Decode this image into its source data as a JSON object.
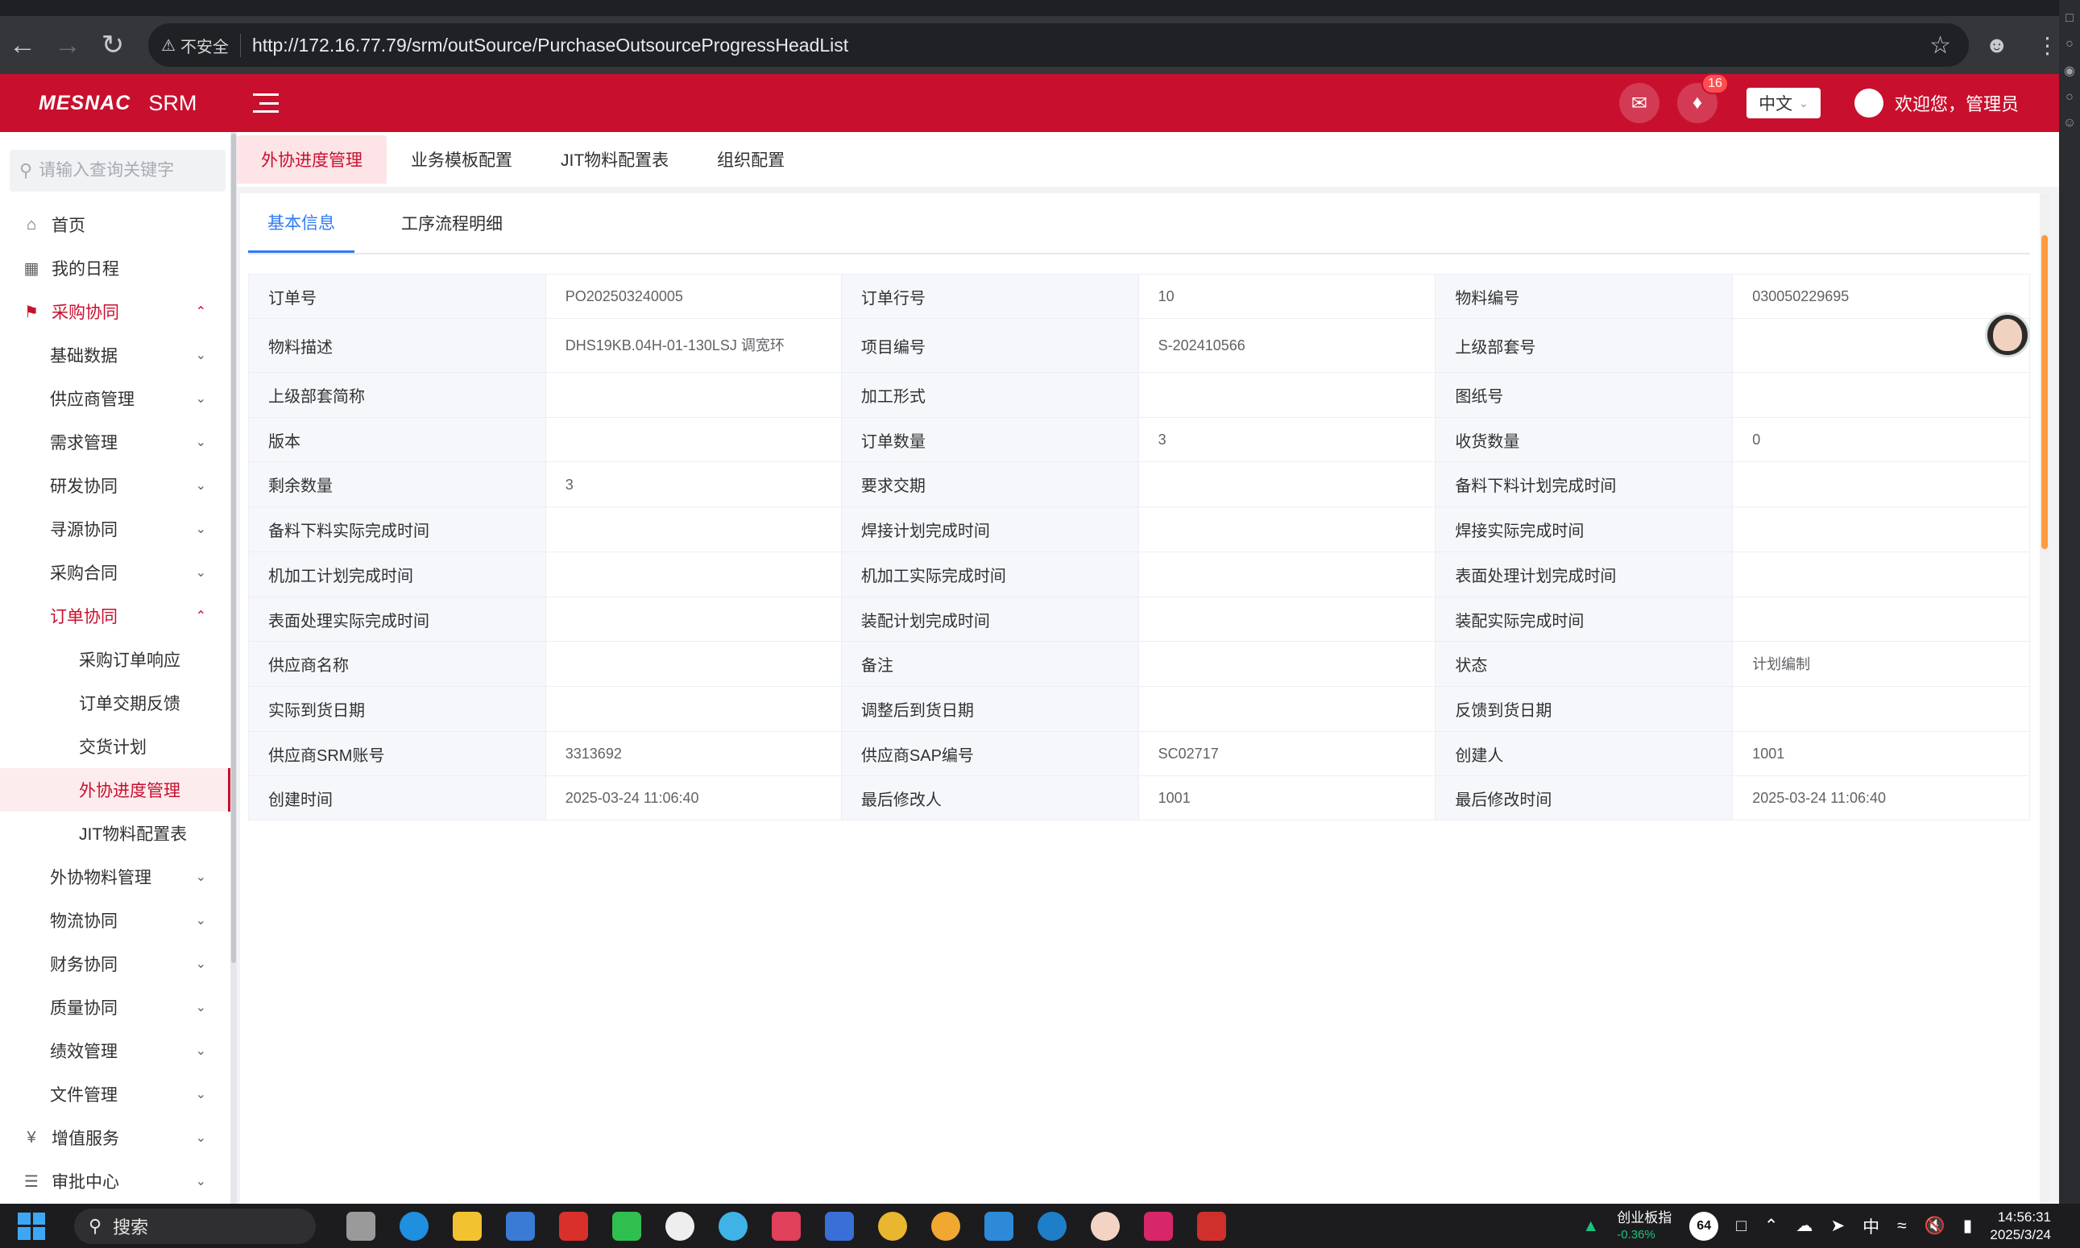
{
  "browser": {
    "insecure_label": "不安全",
    "url": "http://172.16.77.79/srm/outSource/PurchaseOutsourceProgressHeadList"
  },
  "header": {
    "logo": "MESNAC",
    "app_name": "SRM",
    "notification_count": "16",
    "language": "中文",
    "welcome": "欢迎您，管理员"
  },
  "sidebar": {
    "search_placeholder": "请输入查询关键字",
    "items": [
      {
        "label": "首页",
        "icon": "home-icon",
        "level": 1
      },
      {
        "label": "我的日程",
        "icon": "calendar-icon",
        "level": 1
      },
      {
        "label": "采购协同",
        "icon": "flag-icon",
        "level": 1,
        "state": "open"
      },
      {
        "label": "基础数据",
        "level": 2
      },
      {
        "label": "供应商管理",
        "level": 2
      },
      {
        "label": "需求管理",
        "level": 2
      },
      {
        "label": "研发协同",
        "level": 2
      },
      {
        "label": "寻源协同",
        "level": 2
      },
      {
        "label": "采购合同",
        "level": 2
      },
      {
        "label": "订单协同",
        "level": 2,
        "state": "open"
      },
      {
        "label": "采购订单响应",
        "level": 3
      },
      {
        "label": "订单交期反馈",
        "level": 3
      },
      {
        "label": "交货计划",
        "level": 3
      },
      {
        "label": "外协进度管理",
        "level": 3,
        "state": "active"
      },
      {
        "label": "JIT物料配置表",
        "level": 3
      },
      {
        "label": "外协物料管理",
        "level": 2
      },
      {
        "label": "物流协同",
        "level": 2
      },
      {
        "label": "财务协同",
        "level": 2
      },
      {
        "label": "质量协同",
        "level": 2
      },
      {
        "label": "绩效管理",
        "level": 2
      },
      {
        "label": "文件管理",
        "level": 2
      },
      {
        "label": "增值服务",
        "icon": "yen-icon",
        "level": 1
      },
      {
        "label": "审批中心",
        "icon": "doc-icon",
        "level": 1
      }
    ]
  },
  "page_tabs": [
    "外协进度管理",
    "业务模板配置",
    "JIT物料配置表",
    "组织配置"
  ],
  "inner_tabs": [
    "基本信息",
    "工序流程明细"
  ],
  "detail_rows": [
    [
      [
        "订单号",
        "PO202503240005"
      ],
      [
        "订单行号",
        "10"
      ],
      [
        "物料编号",
        "030050229695"
      ]
    ],
    [
      [
        "物料描述",
        "DHS19KB.04H-01-130LSJ 调宽环"
      ],
      [
        "项目编号",
        "S-202410566"
      ],
      [
        "上级部套号",
        ""
      ]
    ],
    [
      [
        "上级部套简称",
        ""
      ],
      [
        "加工形式",
        ""
      ],
      [
        "图纸号",
        ""
      ]
    ],
    [
      [
        "版本",
        ""
      ],
      [
        "订单数量",
        "3"
      ],
      [
        "收货数量",
        "0"
      ]
    ],
    [
      [
        "剩余数量",
        "3"
      ],
      [
        "要求交期",
        ""
      ],
      [
        "备料下料计划完成时间",
        ""
      ]
    ],
    [
      [
        "备料下料实际完成时间",
        ""
      ],
      [
        "焊接计划完成时间",
        ""
      ],
      [
        "焊接实际完成时间",
        ""
      ]
    ],
    [
      [
        "机加工计划完成时间",
        ""
      ],
      [
        "机加工实际完成时间",
        ""
      ],
      [
        "表面处理计划完成时间",
        ""
      ]
    ],
    [
      [
        "表面处理实际完成时间",
        ""
      ],
      [
        "装配计划完成时间",
        ""
      ],
      [
        "装配实际完成时间",
        ""
      ]
    ],
    [
      [
        "供应商名称",
        ""
      ],
      [
        "备注",
        ""
      ],
      [
        "状态",
        "计划编制"
      ]
    ],
    [
      [
        "实际到货日期",
        ""
      ],
      [
        "调整后到货日期",
        ""
      ],
      [
        "反馈到货日期",
        ""
      ]
    ],
    [
      [
        "供应商SRM账号",
        "3313692"
      ],
      [
        "供应商SAP编号",
        "SC02717"
      ],
      [
        "创建人",
        "1001"
      ]
    ],
    [
      [
        "创建时间",
        "2025-03-24 11:06:40"
      ],
      [
        "最后修改人",
        "1001"
      ],
      [
        "最后修改时间",
        "2025-03-24 11:06:40"
      ]
    ]
  ],
  "taskbar": {
    "search_label": "搜索",
    "stock_name": "创业板指",
    "stock_change": "-0.36%",
    "temp": "64",
    "ime": "中",
    "time": "14:56:31",
    "date": "2025/3/24"
  },
  "colors": {
    "brand": "#c8102e",
    "active_blue": "#2f7bf6",
    "label_bg": "#f5f7fa"
  }
}
